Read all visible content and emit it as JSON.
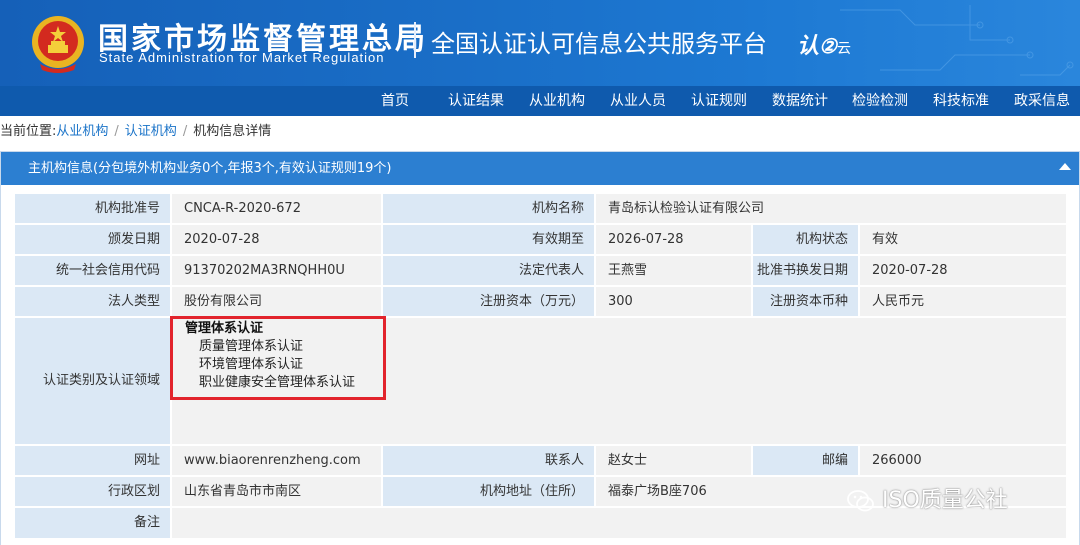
{
  "header": {
    "agency_cn": "国家市场监督管理总局",
    "agency_en": "State Administration  for  Market Regulation",
    "platform_title": "全国认证认可信息公共服务平台",
    "logo_text": "认",
    "logo_suffix": "云"
  },
  "nav": {
    "items": [
      "首页",
      "认证结果",
      "从业机构",
      "从业人员",
      "认证规则",
      "数据统计",
      "检验检测",
      "科技标准",
      "政采信息"
    ]
  },
  "breadcrumb": {
    "prefix": "当前位置:",
    "items": [
      "从业机构",
      "认证机构",
      "机构信息详情"
    ]
  },
  "panel": {
    "title": "主机构信息(分包境外机构业务0个,年报3个,有效认证规则19个)"
  },
  "details": {
    "approval_no_label": "机构批准号",
    "approval_no": "CNCA-R-2020-672",
    "org_name_label": "机构名称",
    "org_name": "青岛标认检验认证有限公司",
    "issue_date_label": "颁发日期",
    "issue_date": "2020-07-28",
    "expiry_label": "有效期至",
    "expiry": "2026-07-28",
    "status_label": "机构状态",
    "status": "有效",
    "credit_code_label": "统一社会信用代码",
    "credit_code": "91370202MA3RNQHH0U",
    "legal_rep_label": "法定代表人",
    "legal_rep": "王燕雪",
    "renewal_date_label": "批准书换发日期",
    "renewal_date": "2020-07-28",
    "entity_type_label": "法人类型",
    "entity_type": "股份有限公司",
    "capital_label": "注册资本（万元）",
    "capital": "300",
    "currency_label": "注册资本币种",
    "currency": "人民币元",
    "cert_scope_label": "认证类别及认证领域",
    "cert_category": "管理体系认证",
    "cert_items": [
      "质量管理体系认证",
      "环境管理体系认证",
      "职业健康安全管理体系认证"
    ],
    "website_label": "网址",
    "website": "www.biaorenrenzheng.com",
    "contact_label": "联系人",
    "contact": "赵女士",
    "postcode_label": "邮编",
    "postcode": "266000",
    "region_label": "行政区划",
    "region": "山东省青岛市市南区",
    "address_label": "机构地址（住所）",
    "address": "福泰广场B座706",
    "remarks_label": "备注",
    "remarks": ""
  },
  "watermark": {
    "text": "ISO质量公社"
  },
  "colors": {
    "header_blue": "#1a6fc8",
    "nav_blue": "#0f5aad",
    "panel_head": "#2c7fd1",
    "label_bg": "#dbe8f5",
    "value_bg": "#f2f2f2",
    "highlight_red": "#e2242c"
  }
}
